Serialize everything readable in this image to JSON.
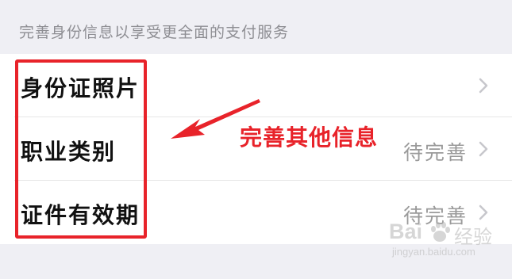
{
  "header": {
    "text": "完善身份信息以享受更全面的支付服务"
  },
  "rows": [
    {
      "label": "身份证照片",
      "value": ""
    },
    {
      "label": "职业类别",
      "value": "待完善"
    },
    {
      "label": "证件有效期",
      "value": "待完善"
    }
  ],
  "annotation": {
    "text": "完善其他信息",
    "color": "#e8232a"
  },
  "watermark": {
    "logo": "Bai",
    "logo_tail": "经验",
    "url": "jingyan.baidu.com"
  },
  "icons": {
    "chevron": "chevron-right-icon",
    "paw": "baidu-paw-icon"
  }
}
